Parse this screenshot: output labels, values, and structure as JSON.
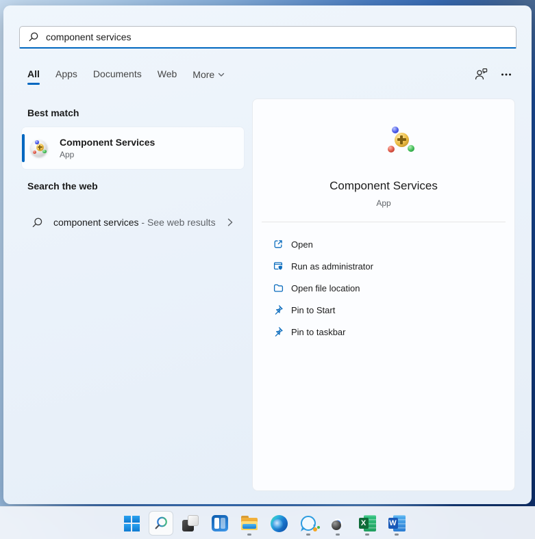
{
  "colors": {
    "accent": "#0067c0",
    "action_icon": "#0b6cbd",
    "selection_bar": "#0067c0"
  },
  "search": {
    "value": "component services",
    "icon": "search-icon"
  },
  "tabs": {
    "items": [
      {
        "label": "All",
        "active": true
      },
      {
        "label": "Apps",
        "active": false
      },
      {
        "label": "Documents",
        "active": false
      },
      {
        "label": "Web",
        "active": false
      },
      {
        "label": "More",
        "active": false,
        "has_chevron": true
      }
    ]
  },
  "header_icons": [
    {
      "name": "feedback-person-chat-icon"
    },
    {
      "name": "ellipsis-icon"
    }
  ],
  "sections": {
    "best_match": {
      "heading": "Best match",
      "item": {
        "title": "Component Services",
        "subtitle": "App",
        "icon": "component-services-icon",
        "selected": true
      }
    },
    "web": {
      "heading": "Search the web",
      "item": {
        "query": "component services",
        "suffix": " - See web results",
        "icon": "search-icon",
        "chevron": "chevron-right-icon"
      }
    }
  },
  "detail": {
    "title": "Component Services",
    "subtitle": "App",
    "icon": "component-services-icon",
    "actions": [
      {
        "label": "Open",
        "icon": "open-icon"
      },
      {
        "label": "Run as administrator",
        "icon": "admin-shield-icon"
      },
      {
        "label": "Open file location",
        "icon": "folder-icon"
      },
      {
        "label": "Pin to Start",
        "icon": "pin-icon"
      },
      {
        "label": "Pin to taskbar",
        "icon": "pin-icon"
      }
    ]
  },
  "taskbar": {
    "items": [
      {
        "name": "start",
        "running": false
      },
      {
        "name": "search",
        "running": false,
        "active": true
      },
      {
        "name": "task-view",
        "running": false
      },
      {
        "name": "widgets",
        "running": false
      },
      {
        "name": "file-explorer",
        "running": true
      },
      {
        "name": "edge",
        "running": false
      },
      {
        "name": "quick-assist",
        "running": true
      },
      {
        "name": "chrome",
        "running": true,
        "badge": "profile-avatar"
      },
      {
        "name": "excel",
        "running": true
      },
      {
        "name": "word",
        "running": true
      }
    ],
    "letters": {
      "excel": "X",
      "word": "W"
    }
  }
}
